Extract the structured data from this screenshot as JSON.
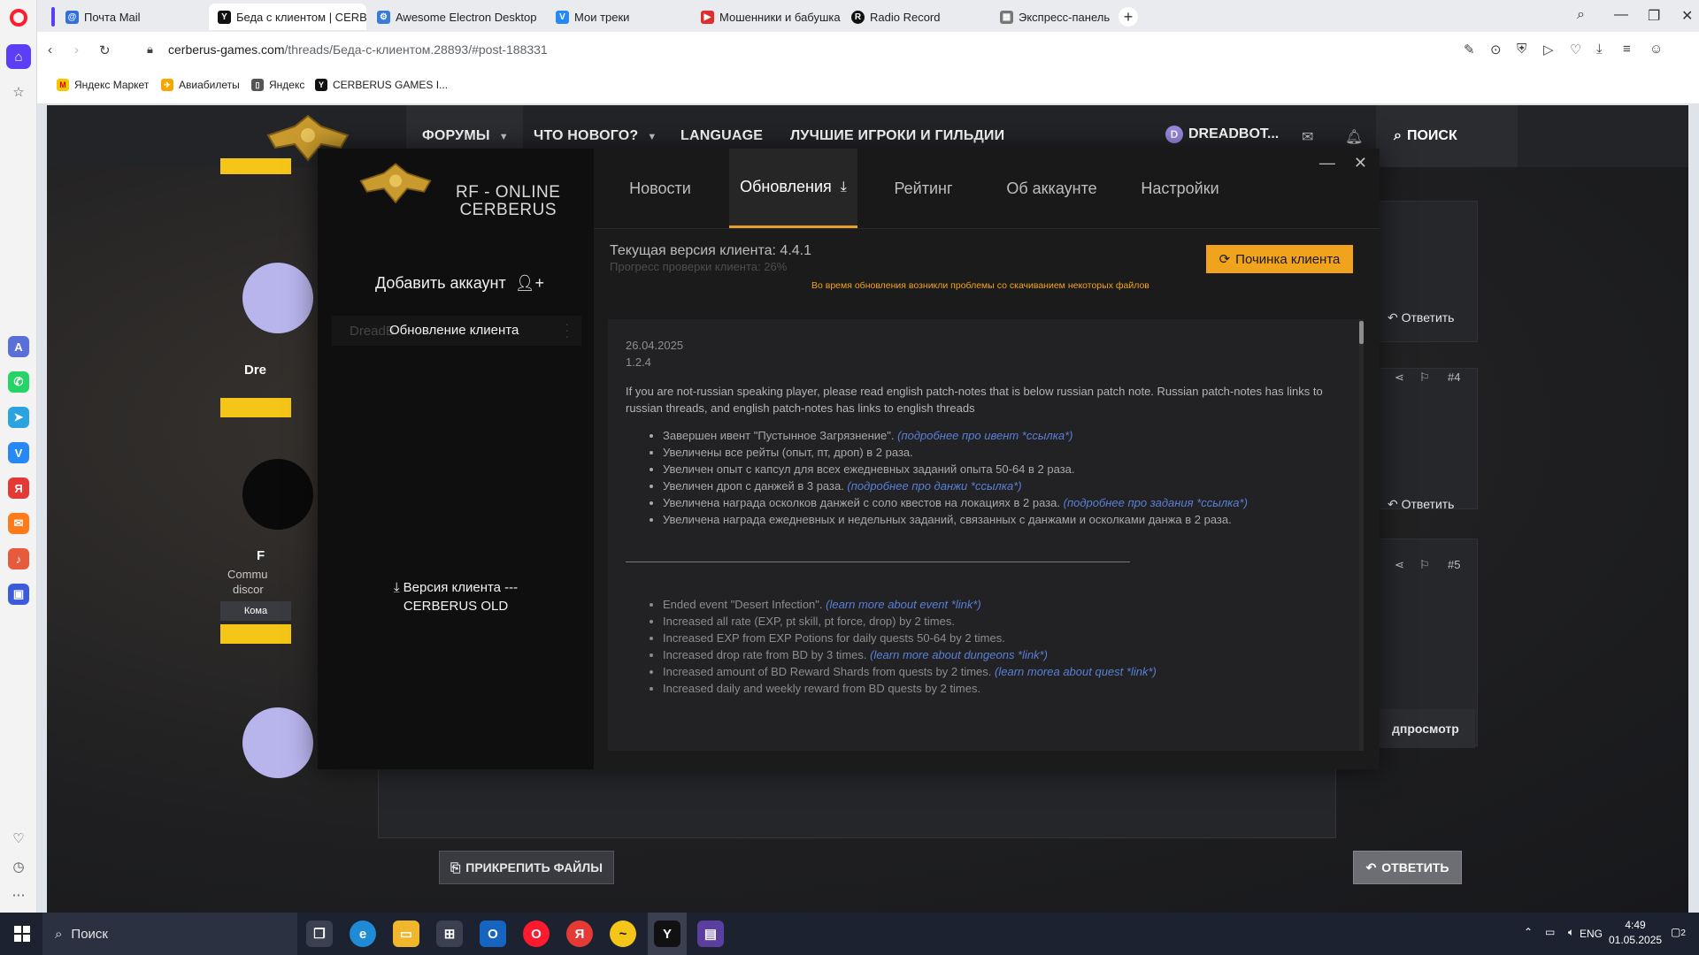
{
  "browser": {
    "tabs": [
      {
        "label": "Почта Mail",
        "color": "#2f6fe0",
        "glyph": "@"
      },
      {
        "label": "Беда с клиентом | CERBERUS",
        "color": "#111111",
        "glyph": "Y"
      },
      {
        "label": "Awesome Electron Desktop",
        "color": "#3a7bd5",
        "glyph": "⚙"
      },
      {
        "label": "Мои треки",
        "color": "#2787f5",
        "glyph": "V"
      },
      {
        "label": "Мошенники и бабушка -",
        "color": "#e02d2d",
        "glyph": "▶"
      },
      {
        "label": "Radio Record",
        "color": "#111111",
        "glyph": "R"
      },
      {
        "label": "Экспресс-панель",
        "color": "#777777",
        "glyph": "▦"
      }
    ],
    "url_host": "cerberus-games.com",
    "url_path": "/threads/Беда-с-клиентом.28893/#post-188331",
    "bookmarks": [
      {
        "label": "Яндекс Маркет",
        "color": "#f7c600",
        "glyph": "M"
      },
      {
        "label": "Авиабилеты",
        "color": "#f7a600",
        "glyph": "✈"
      },
      {
        "label": "Яндекс",
        "color": "#555555",
        "glyph": "▯"
      },
      {
        "label": "CERBERUS GAMES I...",
        "color": "#111111",
        "glyph": "Y"
      }
    ]
  },
  "site": {
    "nav": [
      "ФОРУМЫ",
      "ЧТО НОВОГО?",
      "LANGUAGE",
      "ЛУЧШИЕ ИГРОКИ И ГИЛЬДИИ"
    ],
    "user": "DREADBOT...",
    "user_initial": "D",
    "search": "ПОИСК",
    "reply": "Ответить",
    "post_numbers": [
      "#4",
      "#5"
    ],
    "left_names": [
      "Dre",
      "F"
    ],
    "left_snippets": [
      "Commu",
      "discor",
      "Кома"
    ],
    "preview": "дпросмотр",
    "attach": "ПРИКРЕПИТЬ ФАЙЛЫ",
    "reply_btn": "ОТВЕТИТЬ"
  },
  "launcher": {
    "brand_line1": "RF - ONLINE",
    "brand_line2": "CERBERUS",
    "tabs": [
      {
        "label": "Новости",
        "active": false
      },
      {
        "label": "Обновления",
        "active": true
      },
      {
        "label": "Рейтинг",
        "active": false
      },
      {
        "label": "Об аккаунте",
        "active": false
      },
      {
        "label": "Настройки",
        "active": false
      }
    ],
    "add_account": "Добавить аккаунт",
    "account_row_text": "DreadB",
    "tooltip": "Обновление клиента",
    "version_line1": "Версия клиента ---",
    "version_line2": "CERBERUS OLD",
    "current_version": "Текущая версия клиента: 4.4.1",
    "progress": "Прогресс проверки клиента: 26%",
    "progress_value": 0.26,
    "repair": "Починка клиента",
    "warning": "Во время обновления возникли проблемы со скачиванием некоторых файлов",
    "accent": "#f2a31d",
    "notes": {
      "date": "26.04.2025",
      "ver": "1.2.4",
      "intro": "If you are not-russian speaking player, please read english patch-notes that is below russian patch note. Russian patch-notes has links to russian threads, and english patch-notes has links to english threads",
      "ru": [
        {
          "text": "Завершен ивент \"Пустынное Загрязнение\". ",
          "link": "(подробнее про ивент *ссылка*)"
        },
        {
          "text": "Увеличены все рейты (опыт, пт, дроп) в 2 раза.",
          "link": ""
        },
        {
          "text": "Увеличен опыт с капсул для всех ежедневных заданий опыта 50-64 в 2 раза.",
          "link": ""
        },
        {
          "text": "Увеличен дроп с данжей в 3 раза. ",
          "link": "(подробнее про данжи *ссылка*)"
        },
        {
          "text": "Увеличена награда осколков данжей с соло квестов на локациях в 2 раза. ",
          "link": "(подробнее про задания *ссылка*)"
        },
        {
          "text": "Увеличена награда ежедневных и недельных заданий, связанных с данжами и осколками данжа в 2 раза.",
          "link": ""
        }
      ],
      "en": [
        {
          "text": "Ended event \"Desert Infection\". ",
          "link": "(learn more about event *link*)"
        },
        {
          "text": "Increased all rate (EXP, pt skill, pt force, drop) by 2 times.",
          "link": ""
        },
        {
          "text": "Increased EXP from EXP Potions for daily quests 50-64 by 2 times.",
          "link": ""
        },
        {
          "text": "Increased drop rate from BD by 3 times. ",
          "link": "(learn more about dungeons *link*)"
        },
        {
          "text": "Increased amount of BD Reward Shards from quests by 2 times. ",
          "link": "(learn morea about quest *link*)"
        },
        {
          "text": "Increased daily and weekly reward from BD quests by 2 times.",
          "link": ""
        }
      ]
    }
  },
  "taskbar": {
    "search": "Поиск",
    "lang": "ENG",
    "time": "4:49",
    "date": "01.05.2025",
    "notif_count": "2"
  }
}
